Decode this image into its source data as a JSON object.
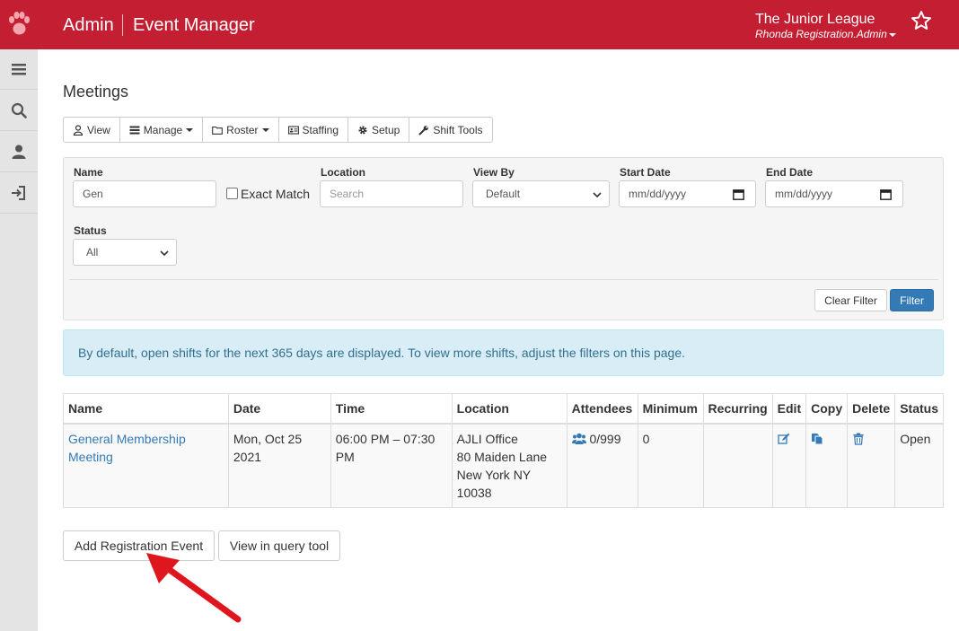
{
  "header": {
    "brand": "Admin",
    "app_name": "Event Manager",
    "org_name": "The Junior League",
    "user_name": "Rhonda Registration.Admin"
  },
  "page": {
    "title": "Meetings"
  },
  "toolbar": {
    "view": "View",
    "manage": "Manage",
    "roster": "Roster",
    "staffing": "Staffing",
    "setup": "Setup",
    "shift_tools": "Shift Tools"
  },
  "filters": {
    "name_label": "Name",
    "name_value": "Gen",
    "exact_match_label": "Exact Match",
    "location_label": "Location",
    "location_placeholder": "Search",
    "view_by_label": "View By",
    "view_by_value": "Default",
    "start_date_label": "Start Date",
    "start_date_placeholder": "mm/dd/yyyy",
    "end_date_label": "End Date",
    "end_date_placeholder": "mm/dd/yyyy",
    "status_label": "Status",
    "status_value": "All",
    "clear_filter": "Clear Filter",
    "filter": "Filter"
  },
  "alert": {
    "text": "By default, open shifts for the next 365 days are displayed. To view more shifts, adjust the filters on this page."
  },
  "table": {
    "headers": [
      "Name",
      "Date",
      "Time",
      "Location",
      "Attendees",
      "Minimum",
      "Recurring",
      "Edit",
      "Copy",
      "Delete",
      "Status"
    ],
    "rows": [
      {
        "name": "General Membership Meeting",
        "date": "Mon, Oct 25 2021",
        "time": "06:00 PM – 07:30 PM",
        "location_line1": "AJLI Office",
        "location_line2": "80 Maiden Lane",
        "location_line3": "New York NY",
        "location_line4": "10038",
        "attendees": "0/999",
        "minimum": "0",
        "recurring": "",
        "status": "Open"
      }
    ]
  },
  "actions": {
    "add_registration_event": "Add Registration Event",
    "view_in_query_tool": "View in query tool"
  },
  "colors": {
    "header_bg": "#c41e32",
    "link": "#337ab7",
    "primary": "#337ab7",
    "alert_bg": "#d9edf7",
    "annotation_arrow": "#e0161e"
  },
  "icons": [
    "paw-icon",
    "star-icon",
    "menu-icon",
    "search-icon",
    "user-icon",
    "sign-in-icon",
    "view-user-icon",
    "manage-list-icon",
    "folder-icon",
    "id-card-icon",
    "gear-icon",
    "wrench-icon",
    "group-icon",
    "edit-icon",
    "copy-icon",
    "trash-icon",
    "calendar-icon",
    "chevron-down-icon"
  ]
}
